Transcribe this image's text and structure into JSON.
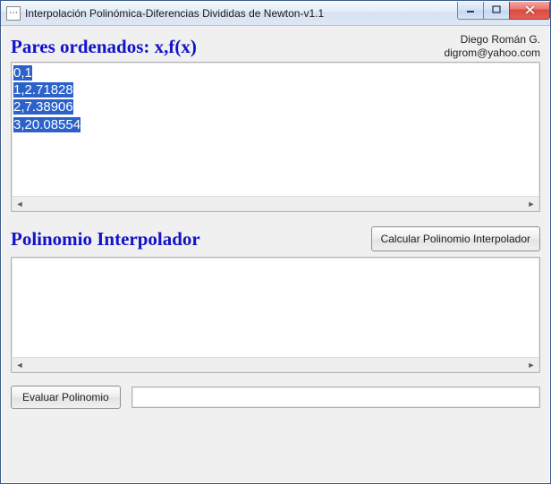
{
  "window": {
    "title": "Interpolación Polinómica-Diferencias Divididas de Newton-v1.1"
  },
  "credits": {
    "author": "Diego Román G.",
    "email": "digrom@yahoo.com"
  },
  "section_pairs": {
    "heading": "Pares ordenados: x,f(x)",
    "lines": [
      "0,1",
      "1,2.71828",
      "2,7.38906",
      "3,20.08554"
    ]
  },
  "section_poly": {
    "heading": "Polinomio Interpolador",
    "button_calc": "Calcular Polinomio Interpolador",
    "content": ""
  },
  "section_eval": {
    "button_eval": "Evaluar Polinomio",
    "value": ""
  }
}
